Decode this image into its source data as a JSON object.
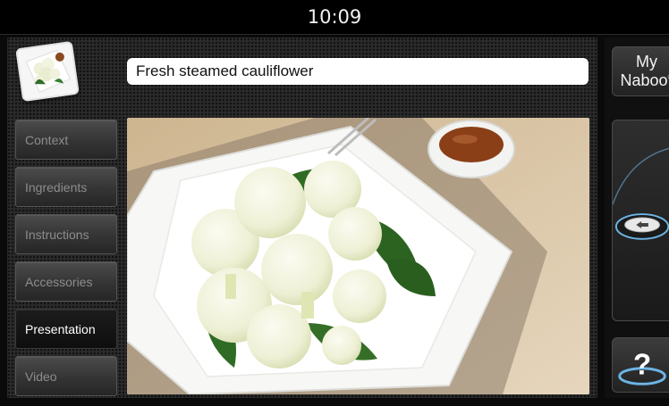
{
  "status_bar": {
    "time": "10:09"
  },
  "recipe": {
    "title": "Fresh steamed cauliflower"
  },
  "menu": {
    "items": [
      {
        "label": "Context",
        "active": false
      },
      {
        "label": "Ingredients",
        "active": false
      },
      {
        "label": "Instructions",
        "active": false
      },
      {
        "label": "Accessories",
        "active": false
      },
      {
        "label": "Presentation",
        "active": true
      },
      {
        "label": "Video",
        "active": false
      }
    ]
  },
  "side": {
    "brand_line1": "My",
    "brand_line2": "Naboo",
    "brand_mark": "®",
    "help_label": "?",
    "back_icon": "back-arrow-icon"
  },
  "colors": {
    "active_menu_text": "#ffffff",
    "inactive_menu_text": "#8d8d8d",
    "accent_blue": "#5fa8d8"
  }
}
